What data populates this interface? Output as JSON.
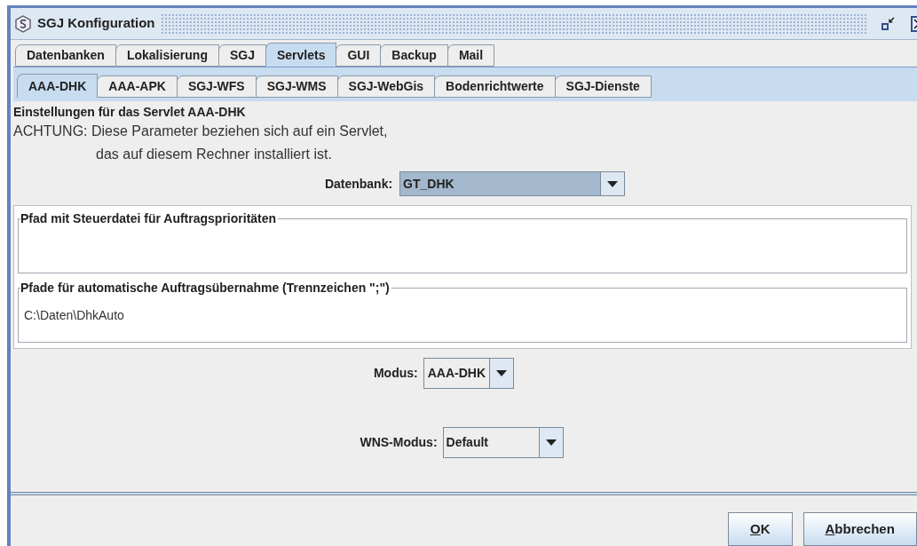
{
  "window": {
    "title": "SGJ Konfiguration"
  },
  "tabs": [
    {
      "label": "Datenbanken",
      "selected": false
    },
    {
      "label": "Lokalisierung",
      "selected": false
    },
    {
      "label": "SGJ",
      "selected": false
    },
    {
      "label": "Servlets",
      "selected": true
    },
    {
      "label": "GUI",
      "selected": false
    },
    {
      "label": "Backup",
      "selected": false
    },
    {
      "label": "Mail",
      "selected": false
    }
  ],
  "subtabs": [
    {
      "label": "AAA-DHK",
      "selected": true
    },
    {
      "label": "AAA-APK",
      "selected": false
    },
    {
      "label": "SGJ-WFS",
      "selected": false
    },
    {
      "label": "SGJ-WMS",
      "selected": false
    },
    {
      "label": "SGJ-WebGis",
      "selected": false
    },
    {
      "label": "Bodenrichtwerte",
      "selected": false
    },
    {
      "label": "SGJ-Dienste",
      "selected": false
    }
  ],
  "heading": "Einstellungen für das Servlet AAA-DHK",
  "notice": [
    "ACHTUNG: Diese Parameter beziehen sich auf ein Servlet,",
    "das auf diesem Rechner installiert ist."
  ],
  "datenbank": {
    "label": "Datenbank:",
    "value": "GT_DHK",
    "focused": true
  },
  "groups": [
    {
      "title": "Pfad mit Steuerdatei für Auftragsprioritäten"
    },
    {
      "title": "Pfade für automatische Auftragsübernahme (Trennzeichen \";\")",
      "value": "C:\\Daten\\DhkAuto"
    }
  ],
  "modus": {
    "label": "Modus:",
    "value": "AAA-DHK"
  },
  "wns_modus": {
    "label": "WNS-Modus:",
    "value": "Default"
  },
  "buttons": [
    {
      "label": "OK",
      "mnemonic_first": true
    },
    {
      "label": "Abbrechen",
      "mnemonic_first": true
    }
  ]
}
